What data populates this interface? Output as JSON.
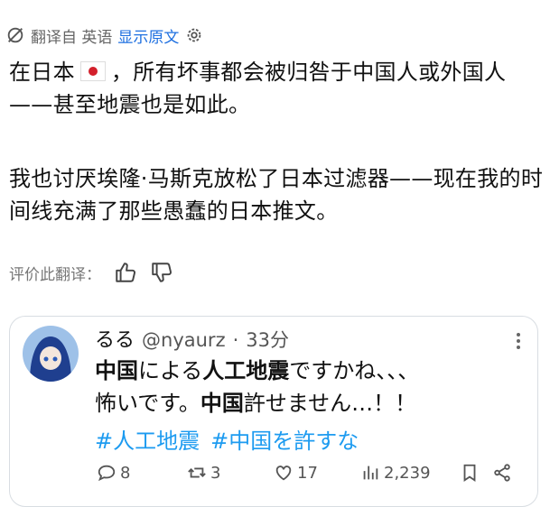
{
  "translation_bar": {
    "label": "翻译自 英语",
    "show_original": "显示原文"
  },
  "post": {
    "para1_before_flag": "在日本",
    "para1_after_flag": "，所有坏事都会被归咎于中国人或外国人——甚至地震也是如此。",
    "para2": "我也讨厌埃隆·马斯克放松了日本过滤器——现在我的时间线充满了那些愚蠢的日本推文。"
  },
  "rate_translation": {
    "label": "评价此翻译："
  },
  "embedded_tweet": {
    "author_name": "るる",
    "handle": "@nyaurz",
    "separator": "·",
    "time": "33分",
    "line1_a": "中国",
    "line1_b": "による",
    "line1_c": "人工地震",
    "line1_d": "ですかね、、、",
    "line2_a": "怖いです。",
    "line2_b": "中国",
    "line2_c": "許せません…！！",
    "hashtag1": "#人工地震",
    "hashtag2": "#中国を許すな",
    "replies": "8",
    "retweets": "3",
    "likes": "17",
    "views": "2,239"
  },
  "colors": {
    "link": "#1d6fe0",
    "hashtag": "#1d9bf0",
    "flag_red": "#d3202b"
  }
}
